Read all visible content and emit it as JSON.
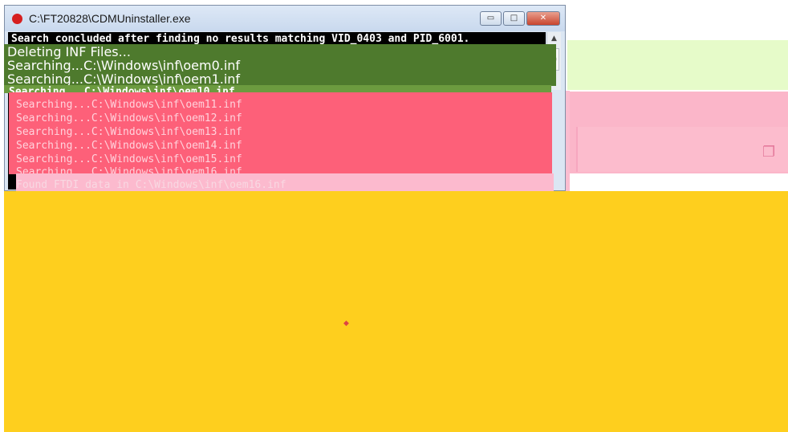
{
  "window": {
    "title": "C:\\FT20828\\CDMUninstaller.exe",
    "app_icon": "red-circle-icon",
    "controls": {
      "minimize": "▭",
      "maximize": "□",
      "close": "✕"
    }
  },
  "console": {
    "lines": [
      "Search concluded after finding no results matching VID_0403 and PID_6001."
    ],
    "green_lines": [
      "Deleting INF Files...",
      "Searching...C:\\Windows\\inf\\oem0.inf",
      "Searching...C:\\Windows\\inf\\oem1.inf"
    ],
    "highlight_line": "Searching...C:\\Windows\\inf\\oem10.inf",
    "red_lines": [
      "Searching...C:\\Windows\\inf\\oem11.inf",
      "Searching...C:\\Windows\\inf\\oem12.inf",
      "Searching...C:\\Windows\\inf\\oem13.inf",
      "Searching...C:\\Windows\\inf\\oem14.inf",
      "Searching...C:\\Windows\\inf\\oem15.inf",
      "Searching...C:\\Windows\\inf\\oem16.inf"
    ],
    "found_line": "Found FTDI data in C:\\Windows\\inf\\oem16.inf"
  },
  "scrollbar": {
    "up_arrow": "▲",
    "thumb_grip": "≡"
  },
  "colors": {
    "green_band": "#4e7a2d",
    "red_band": "#fd6079",
    "pink_band": "#fbbdd0",
    "gold_area": "#fecf1e",
    "lime_area": "#e6fbc9"
  }
}
